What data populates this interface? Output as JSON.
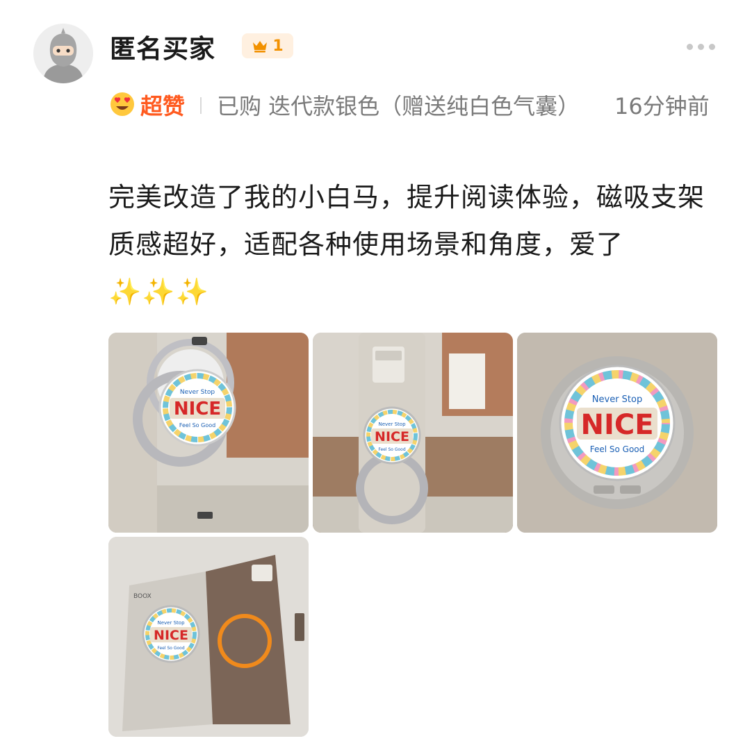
{
  "reviewer": {
    "name": "匿名买家",
    "level": "1",
    "avatar_icon": "ninja-avatar-icon",
    "level_icon": "crown-icon"
  },
  "meta": {
    "rating_icon": "heart-eyes-emoji-icon",
    "rating_label": "超赞",
    "purchase_info": "已购 迭代款银色（赠送纯白色气囊）",
    "time_ago": "16分钟前"
  },
  "review_text": "完美改造了我的小白马，提升阅读体验，磁吸支架质感超好，适配各种使用场景和角度，爱了✨✨✨",
  "photos": [
    {
      "id": "photo-1",
      "badge_top": "Never Stop",
      "badge_main": "NICE",
      "badge_bottom": "Feel So Good"
    },
    {
      "id": "photo-2",
      "badge_top": "Never Stop",
      "badge_main": "NICE",
      "badge_bottom": "Feel So Good"
    },
    {
      "id": "photo-3",
      "badge_top": "Never Stop",
      "badge_main": "NICE",
      "badge_bottom": "Feel So Good"
    },
    {
      "id": "photo-4",
      "badge_top": "Never Stop",
      "badge_main": "NICE",
      "badge_bottom": "Feel So Good",
      "brand_label": "BOOX"
    }
  ],
  "colors": {
    "accent_orange": "#ff5a1f",
    "level_gold": "#f29100",
    "meta_gray": "#7a7a7a"
  }
}
